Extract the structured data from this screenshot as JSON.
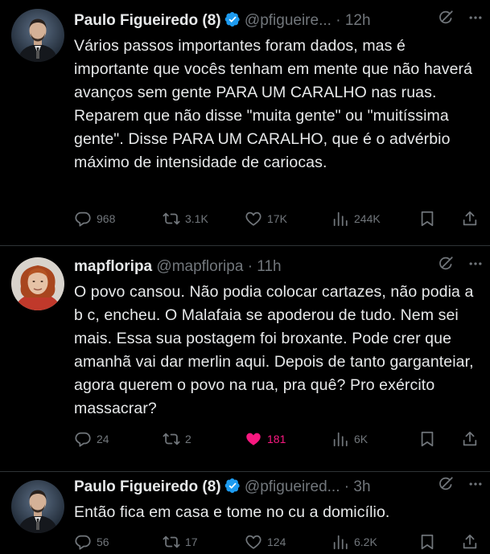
{
  "colors": {
    "background": "#000000",
    "text": "#e7e9ea",
    "muted": "#71767b",
    "verified": "#1d9bf0",
    "like": "#f91880"
  },
  "tweets": [
    {
      "name": "Paulo Figueiredo (8)",
      "handle": "@pfigueire...",
      "dot": "·",
      "time": "12h",
      "verified": true,
      "text": "Vários passos importantes foram dados, mas é importante que vocês tenham em mente que não haverá avanços sem gente PARA UM CARALHO nas ruas. Reparem que não disse \"muita gente\" ou \"muitíssima gente\". Disse PARA UM CARALHO, que é o advérbio máximo de intensidade de cariocas.",
      "replies": "968",
      "retweets": "3.1K",
      "likes": "17K",
      "views": "244K",
      "liked": false,
      "icons": [
        "grok-icon",
        "more-icon",
        "reply-icon",
        "retweet-icon",
        "like-icon",
        "views-icon",
        "bookmark-icon",
        "share-icon"
      ]
    },
    {
      "name": "mapfloripa",
      "handle": "@mapfloripa",
      "dot": "·",
      "time": "11h",
      "verified": false,
      "text": "O povo cansou. Não podia colocar cartazes, não podia a b c, encheu. O Malafaia se apoderou de tudo. Nem sei mais. Essa sua postagem foi broxante. Pode crer que amanhã vai dar merlin aqui. Depois de tanto garganteiar, agora querem o povo na rua, pra quê? Pro exército massacrar?",
      "replies": "24",
      "retweets": "2",
      "likes": "181",
      "views": "6K",
      "liked": true
    },
    {
      "name": "Paulo Figueiredo (8)",
      "handle": "@pfigueired...",
      "dot": "·",
      "time": "3h",
      "verified": true,
      "text": "Então fica em casa e tome no cu a domicílio.",
      "replies": "56",
      "retweets": "17",
      "likes": "124",
      "views": "6.2K",
      "liked": false
    }
  ]
}
